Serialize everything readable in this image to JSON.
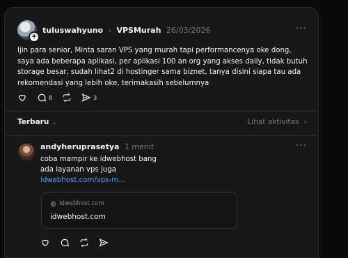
{
  "post": {
    "username": "tuluswahyuno",
    "community": "VPSMurah",
    "date": "26/03/2026",
    "more": "···",
    "text": "Ijin para senior, Minta saran VPS yang murah tapi performancenya oke dong, saya ada beberapa aplikasi, per aplikasi 100 an org yang akses daily, tidak butuh storage besar, sudah lihat2 di hostinger sama biznet, tanya disini siapa tau ada rekomendasi yang lebih oke, terimakasih sebelumnya",
    "comments": "8",
    "shares": "3"
  },
  "sort": {
    "label": "Terbaru",
    "activity": "Lihat aktivitas"
  },
  "reply": {
    "username": "andyheruprasetya",
    "time": "1 menit",
    "more": "···",
    "line1": "coba mampir ke idwebhost bang",
    "line2": "ada layanan vps juga",
    "link_text": "idwebhost.com/vps-m…",
    "card_domain": "idwebhost.com",
    "card_title": "idwebhost.com"
  },
  "icons": [
    "heart-icon",
    "comment-icon",
    "repost-icon",
    "share-icon",
    "globe-icon",
    "chevron-down-icon",
    "chevron-right-icon",
    "plus-icon"
  ]
}
